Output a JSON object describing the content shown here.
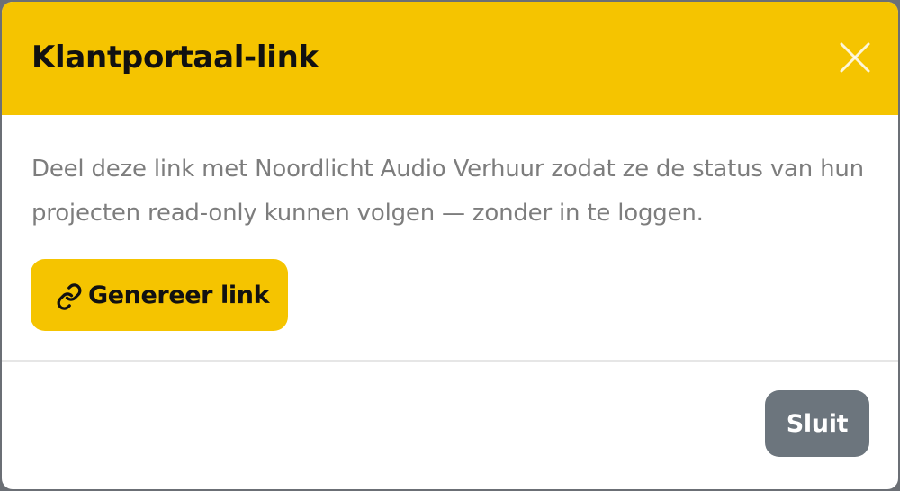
{
  "modal": {
    "title": "Klantportaal-link",
    "close_icon": "close-icon",
    "description": "Deel deze link met Noordlicht Audio Verhuur zodat ze de status van hun projecten read-only kunnen volgen — zonder in te loggen.",
    "generate_button": {
      "icon": "link-icon",
      "label": "Genereer link"
    },
    "footer": {
      "close_label": "Sluit"
    }
  },
  "colors": {
    "accent": "#f5c400",
    "close_button": "#6c757d",
    "description_text": "#7d7d7d",
    "overlay": "#6b6f75"
  }
}
